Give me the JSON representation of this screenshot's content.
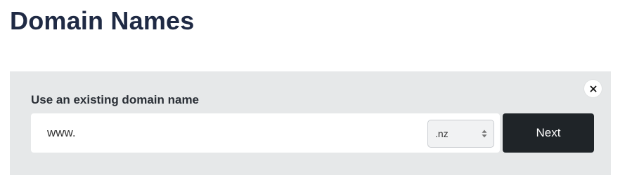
{
  "page": {
    "title": "Domain Names"
  },
  "panel": {
    "label": "Use an existing domain name",
    "input_value": "www.",
    "tld_selected": ".nz",
    "next_label": "Next",
    "close_icon": "close-icon"
  },
  "colors": {
    "title": "#1f2a44",
    "panel_bg": "#e6e8e9",
    "button_bg": "#1f2428"
  }
}
